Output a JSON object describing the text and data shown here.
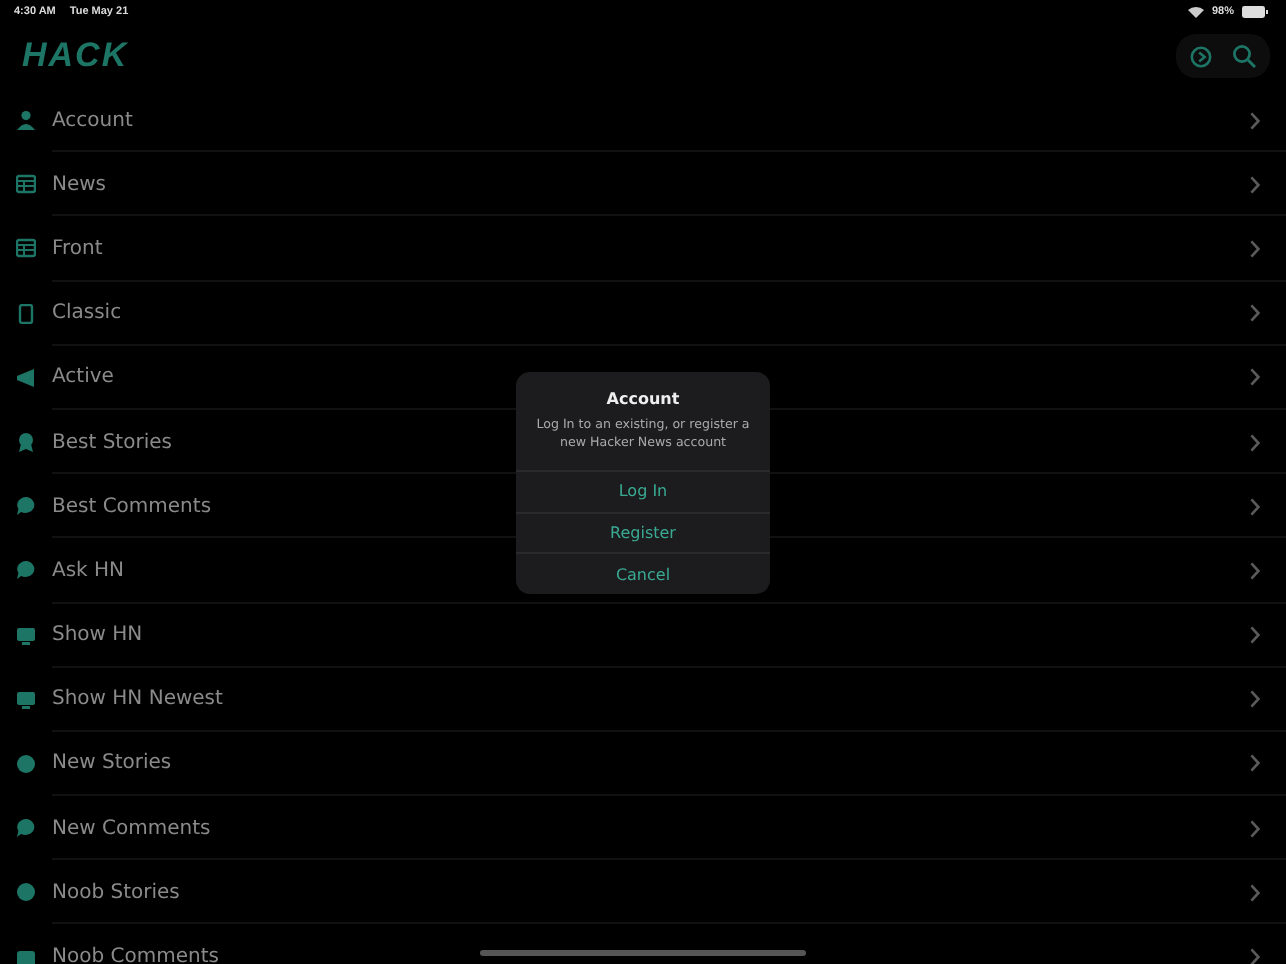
{
  "status_bar": {
    "time": "4:30 AM",
    "date": "Tue May 21",
    "battery": "98%"
  },
  "header": {
    "logo": "HACK"
  },
  "menu": [
    {
      "label": "Account"
    },
    {
      "label": "News"
    },
    {
      "label": "Front"
    },
    {
      "label": "Classic"
    },
    {
      "label": "Active"
    },
    {
      "label": "Best Stories"
    },
    {
      "label": "Best Comments"
    },
    {
      "label": "Ask HN"
    },
    {
      "label": "Show HN"
    },
    {
      "label": "Show HN Newest"
    },
    {
      "label": "New Stories"
    },
    {
      "label": "New Comments"
    },
    {
      "label": "Noob Stories"
    },
    {
      "label": "Noob Comments"
    }
  ],
  "dialog": {
    "title": "Account",
    "message": "Log In to an existing, or register a new Hacker News account",
    "actions": [
      "Log In",
      "Register",
      "Cancel"
    ]
  }
}
